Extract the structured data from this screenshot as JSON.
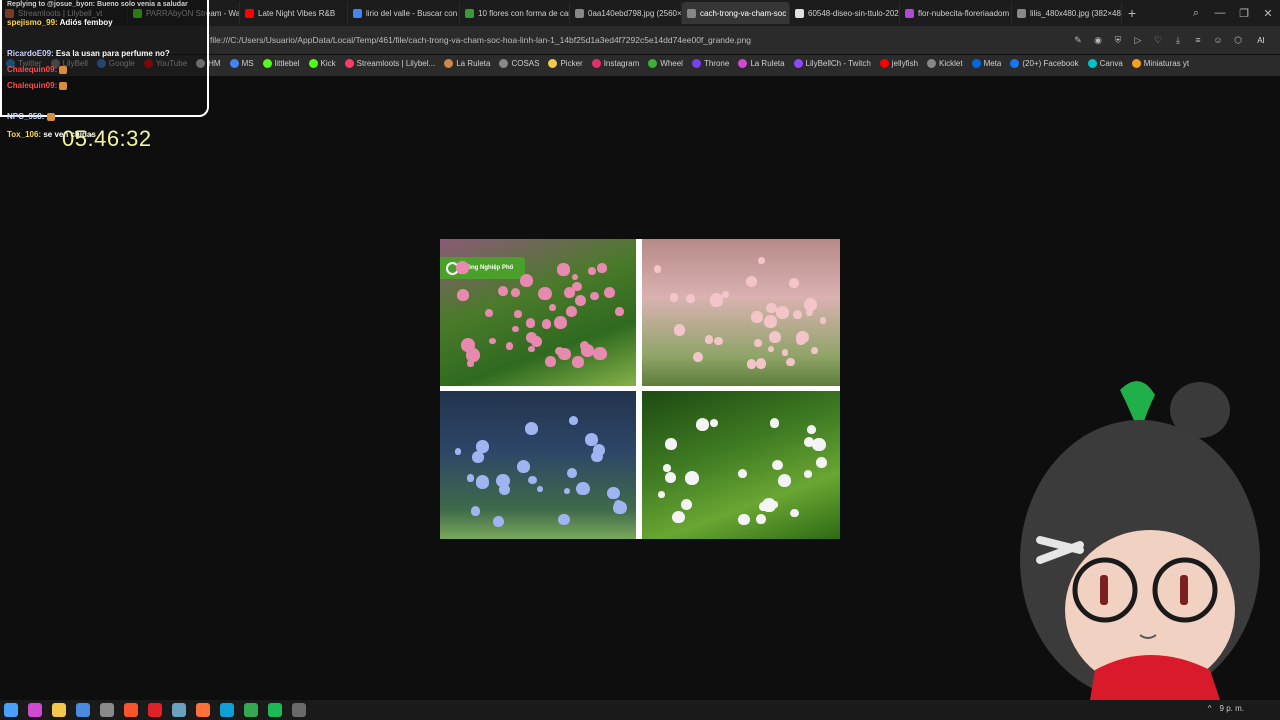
{
  "tabs": [
    {
      "label": "Streamloots | Lilybell_vt",
      "color": "#ff6a3d"
    },
    {
      "label": "PARRAbyON Stream - Wat",
      "color": "#53fc18"
    },
    {
      "label": "Late Night Vibes R&B",
      "color": "#ff0000"
    },
    {
      "label": "lirio del valle - Buscar con",
      "color": "#4285f4"
    },
    {
      "label": "10 flores con forma de cam",
      "color": "#3a9a3a"
    },
    {
      "label": "0aa140ebd798.jpg (2560×",
      "color": "#888888"
    },
    {
      "label": "cach-trong-va-cham-soc",
      "color": "#888888",
      "active": true
    },
    {
      "label": "60548-diseo-sin-ttulo-202",
      "color": "#e0e0e0"
    },
    {
      "label": "flor-nubecita-floreriaadom",
      "color": "#b04ad0"
    },
    {
      "label": "lilis_480x480.jpg (382×48",
      "color": "#888888"
    }
  ],
  "address": {
    "url": "file:///C:/Users/Usuario/AppData/Local/Temp/461/file/cach-trong-va-cham-soc-hoa-linh-lan-1_14bf25d1a3ed4f7292c5e14dd74ee00f_grande.png",
    "ai_label": "AI"
  },
  "bookmarks": [
    {
      "label": "Twitter",
      "color": "#1da1f2"
    },
    {
      "label": "LilyBell",
      "color": "#888888"
    },
    {
      "label": "Google",
      "color": "#4285f4"
    },
    {
      "label": "YouTube",
      "color": "#ff0000"
    },
    {
      "label": "HM",
      "color": "#dddddd"
    },
    {
      "label": "MS",
      "color": "#4285f4"
    },
    {
      "label": "littlebel",
      "color": "#53fc18"
    },
    {
      "label": "Kick",
      "color": "#53fc18"
    },
    {
      "label": "Streamloots | Lilybel...",
      "color": "#ff3d6a"
    },
    {
      "label": "La Ruleta",
      "color": "#cc8844"
    },
    {
      "label": "COSAS",
      "color": "#888888"
    },
    {
      "label": "Picker",
      "color": "#f2c94c"
    },
    {
      "label": "Instagram",
      "color": "#e1306c"
    },
    {
      "label": "Wheel",
      "color": "#3ab03a"
    },
    {
      "label": "Throne",
      "color": "#7b3ff2"
    },
    {
      "label": "La Ruleta",
      "color": "#d04ad0"
    },
    {
      "label": "LilyBellCh - Twitch",
      "color": "#9146ff"
    },
    {
      "label": "jellyfish",
      "color": "#ff0000"
    },
    {
      "label": "Kicklet",
      "color": "#888888"
    },
    {
      "label": "Meta",
      "color": "#0668e1"
    },
    {
      "label": "(20+) Facebook",
      "color": "#1877f2"
    },
    {
      "label": "Canva",
      "color": "#00c4cc"
    },
    {
      "label": "Miniaturas yt",
      "color": "#f2a020"
    }
  ],
  "chat": {
    "reply_note": "Replying to @josue_byon: Bueno solo venia a saludar",
    "messages": [
      {
        "user": "spejismo_99:",
        "text": "Adiós femboy",
        "color": "yellow"
      },
      {
        "user": "RicardoE09:",
        "text": "Esa la usan para perfume no?",
        "color": "blue"
      },
      {
        "user": "Chalequin09:",
        "text": "",
        "color": "red"
      },
      {
        "user": "Chalequin09:",
        "text": "",
        "color": "red"
      },
      {
        "user": "NPC_958:",
        "text": "",
        "color": "blue"
      },
      {
        "user": "Tox_106:",
        "text": "se ven chidas",
        "color": "yellow"
      }
    ]
  },
  "timer": "05:46:32",
  "image": {
    "watermark_text": "Nông Nghiệp Phố"
  },
  "taskbar": {
    "clock": "9 p. m."
  }
}
